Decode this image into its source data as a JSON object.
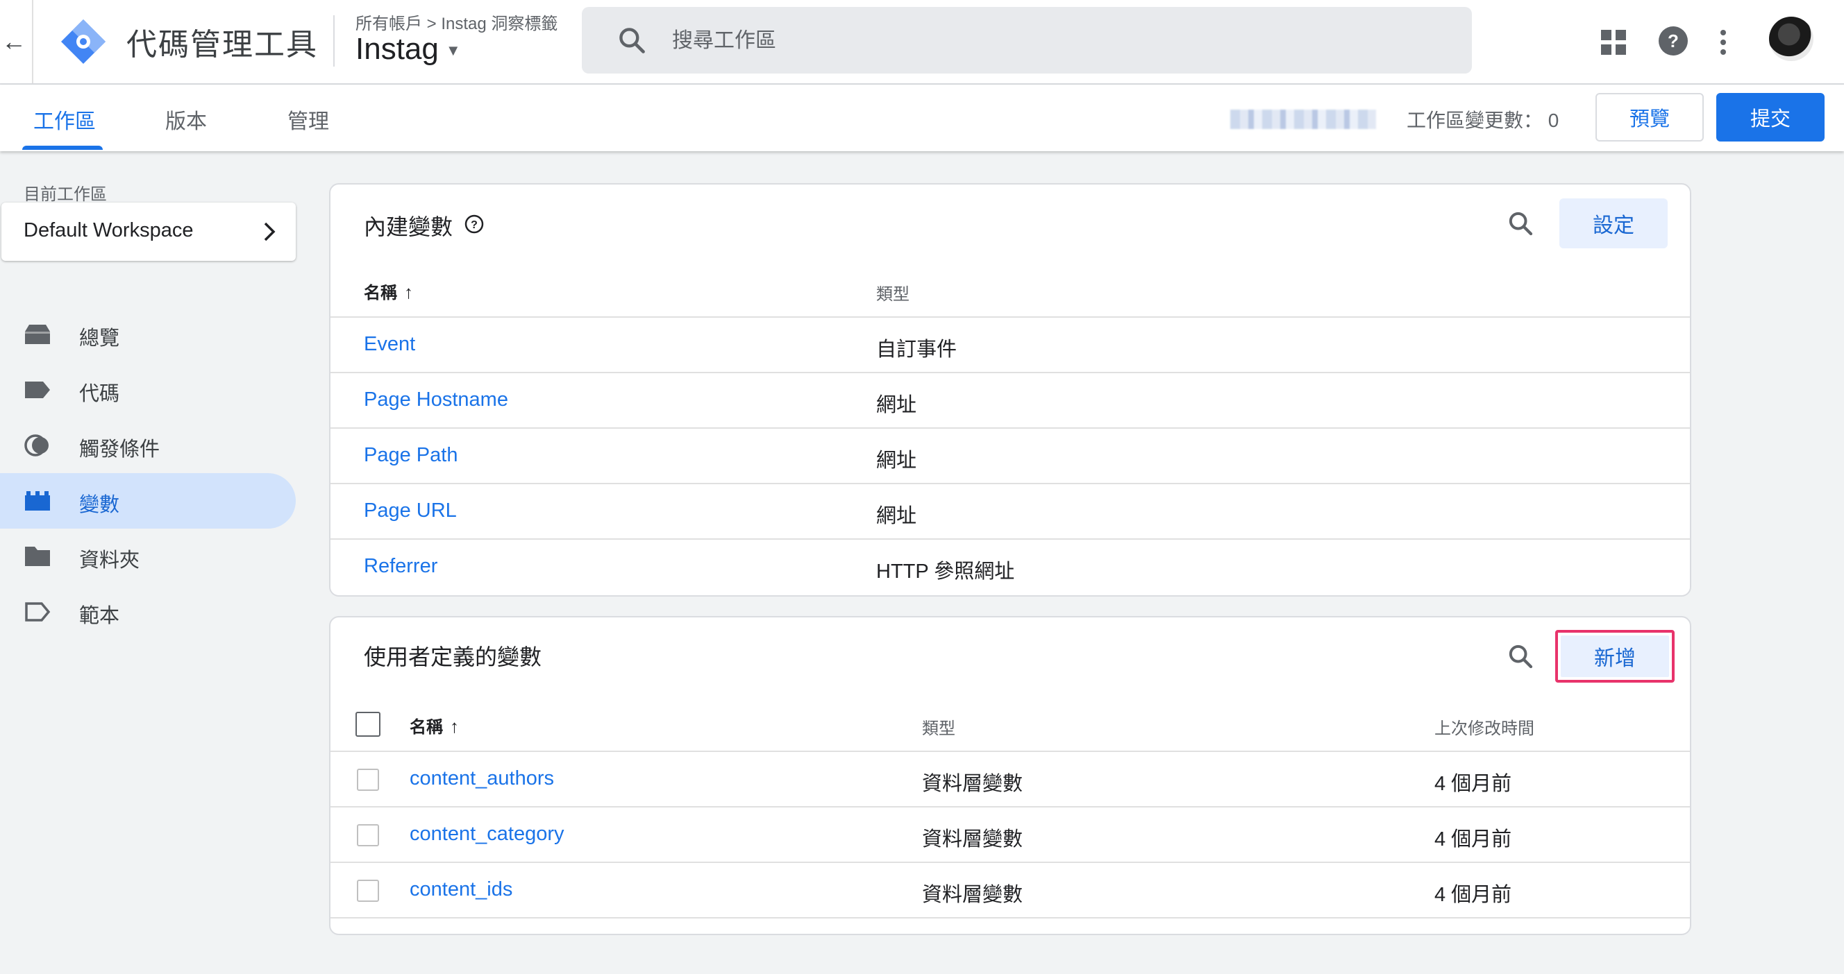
{
  "header": {
    "back_glyph": "←",
    "app_title": "代碼管理工具",
    "breadcrumb": "所有帳戶 > Instag 洞察標籤",
    "container_name": "Instag",
    "search_placeholder": "搜尋工作區"
  },
  "tabs": [
    {
      "label": "工作區",
      "active": true
    },
    {
      "label": "版本",
      "active": false
    },
    {
      "label": "管理",
      "active": false
    }
  ],
  "toolbar": {
    "workspace_changes": "工作區變更數： 0",
    "preview_label": "預覽",
    "submit_label": "提交"
  },
  "sidebar": {
    "current_workspace_label": "目前工作區",
    "workspace_name": "Default Workspace",
    "items": [
      {
        "label": "總覽",
        "icon": "overview-icon",
        "active": false
      },
      {
        "label": "代碼",
        "icon": "tag-icon",
        "active": false
      },
      {
        "label": "觸發條件",
        "icon": "trigger-icon",
        "active": false
      },
      {
        "label": "變數",
        "icon": "variable-icon",
        "active": true
      },
      {
        "label": "資料夾",
        "icon": "folder-icon",
        "active": false
      },
      {
        "label": "範本",
        "icon": "template-icon",
        "active": false
      }
    ]
  },
  "builtin": {
    "title": "內建變數",
    "configure_label": "設定",
    "col_name": "名稱",
    "col_type": "類型",
    "sort_arrow": "↑",
    "rows": [
      {
        "name": "Event",
        "type": "自訂事件"
      },
      {
        "name": "Page Hostname",
        "type": "網址"
      },
      {
        "name": "Page Path",
        "type": "網址"
      },
      {
        "name": "Page URL",
        "type": "網址"
      },
      {
        "name": "Referrer",
        "type": "HTTP 參照網址"
      }
    ]
  },
  "user_defined": {
    "title": "使用者定義的變數",
    "new_label": "新增",
    "col_name": "名稱",
    "col_type": "類型",
    "col_modified": "上次修改時間",
    "sort_arrow": "↑",
    "rows": [
      {
        "name": "content_authors",
        "type": "資料層變數",
        "modified": "4 個月前"
      },
      {
        "name": "content_category",
        "type": "資料層變數",
        "modified": "4 個月前"
      },
      {
        "name": "content_ids",
        "type": "資料層變數",
        "modified": "4 個月前"
      }
    ]
  },
  "colors": {
    "accent": "#1a73e8",
    "highlight_border": "#e8336b",
    "sidebar_active": "#d2e3fc"
  }
}
